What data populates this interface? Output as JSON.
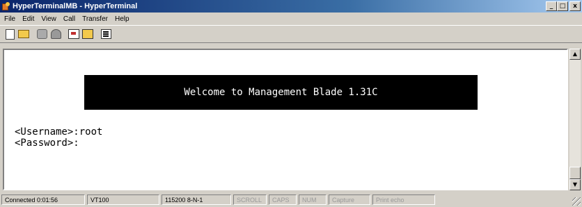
{
  "window": {
    "title": "HyperTerminalMB - HyperTerminal",
    "minimize_label": "_",
    "maximize_label": "□",
    "close_label": "x"
  },
  "menu": [
    "File",
    "Edit",
    "View",
    "Call",
    "Transfer",
    "Help"
  ],
  "toolbar": {
    "icons": [
      "new-icon",
      "open-icon",
      "call-icon",
      "disconnect-icon",
      "send-icon",
      "receive-icon",
      "properties-icon"
    ]
  },
  "terminal": {
    "banner": "Welcome to Management Blade 1.31C",
    "line1": "<Username>:root",
    "line2": "<Password>:"
  },
  "scrollbar": {
    "up_label": "▲",
    "down_label": "▼"
  },
  "status": {
    "connected": "Connected 0:01:56",
    "emulation": "VT100",
    "port": "115200 8-N-1",
    "scroll": "SCROLL",
    "caps": "CAPS",
    "num": "NUM",
    "capture": "Capture",
    "print_echo": "Print echo"
  },
  "colors": {
    "title_active": "#0a246a",
    "terminal_bg": "#ffffff",
    "banner_bg": "#000000",
    "chrome": "#d4d0c8"
  }
}
